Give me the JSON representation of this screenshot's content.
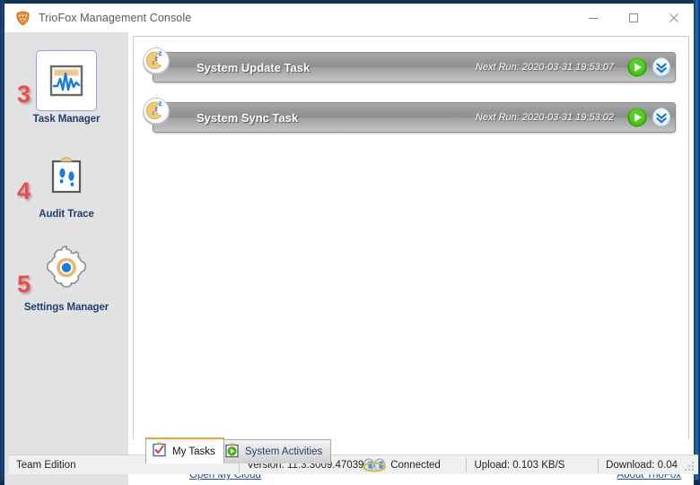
{
  "window": {
    "title": "TrioFox Management Console",
    "app_icon": "triofox-shield-icon",
    "minimize_label": "Minimize",
    "maximize_label": "Maximize",
    "close_label": "Close"
  },
  "sidebar": {
    "items": [
      {
        "annotation": "3",
        "label": "Task Manager",
        "icon": "task-manager-icon",
        "selected": true
      },
      {
        "annotation": "4",
        "label": "Audit Trace",
        "icon": "audit-trace-icon",
        "selected": false
      },
      {
        "annotation": "5",
        "label": "Settings Manager",
        "icon": "settings-manager-icon",
        "selected": false
      }
    ]
  },
  "main": {
    "tasks": [
      {
        "name": "System Update Task",
        "next_run": "Next Run: 2020-03-31 19:53:07",
        "status_icon": "sleeping-moon-icon",
        "run_button": "run-task-button",
        "expand_button": "expand-task-button"
      },
      {
        "name": "System Sync Task",
        "next_run": "Next Run: 2020-03-31 19:53:02",
        "status_icon": "sleeping-moon-icon",
        "run_button": "run-task-button",
        "expand_button": "expand-task-button"
      }
    ],
    "tabs": [
      {
        "label": "My Tasks",
        "icon": "clipboard-check-icon",
        "active": true
      },
      {
        "label": "System Activities",
        "icon": "clipboard-play-icon",
        "active": false
      }
    ]
  },
  "links": {
    "open_my_cloud": "Open My Cloud",
    "about_triofox": "About TrioFox"
  },
  "statusbar": {
    "edition": "Team Edition",
    "version": "Version: 11.3.3009.47039",
    "connection_icon": "connection-icon",
    "connection": "Connected",
    "upload": "Upload: 0.103 KB/S",
    "download": "Download: 0.04"
  },
  "colors": {
    "accent_orange": "#e8a33d",
    "frame_blue": "#1d4a82",
    "label_navy": "#20406e",
    "link_blue": "#1a4f9e",
    "annotation_red": "#f04a46",
    "run_green": "#3ec40d",
    "task_gray": "#9d9d9d"
  }
}
